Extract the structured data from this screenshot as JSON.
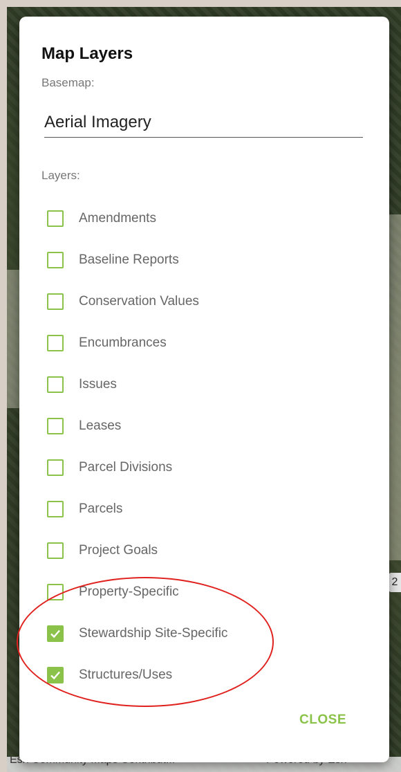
{
  "dialog": {
    "title": "Map Layers",
    "basemap_label": "Basemap:",
    "basemap_value": "Aerial Imagery",
    "layers_label": "Layers:",
    "close_label": "CLOSE"
  },
  "layers": [
    {
      "label": "Amendments",
      "checked": false
    },
    {
      "label": "Baseline Reports",
      "checked": false
    },
    {
      "label": "Conservation Values",
      "checked": false
    },
    {
      "label": "Encumbrances",
      "checked": false
    },
    {
      "label": "Issues",
      "checked": false
    },
    {
      "label": "Leases",
      "checked": false
    },
    {
      "label": "Parcel Divisions",
      "checked": false
    },
    {
      "label": "Parcels",
      "checked": false
    },
    {
      "label": "Project Goals",
      "checked": false
    },
    {
      "label": "Property-Specific",
      "checked": false
    },
    {
      "label": "Stewardship Site-Specific",
      "checked": true
    },
    {
      "label": "Structures/Uses",
      "checked": true
    }
  ],
  "map": {
    "badge_text": "2",
    "attribution_left": "Esri Community Maps Contribut...",
    "attribution_right": "Powered by Esri"
  },
  "colors": {
    "accent": "#8bc34a",
    "annotation": "#e0211d"
  }
}
